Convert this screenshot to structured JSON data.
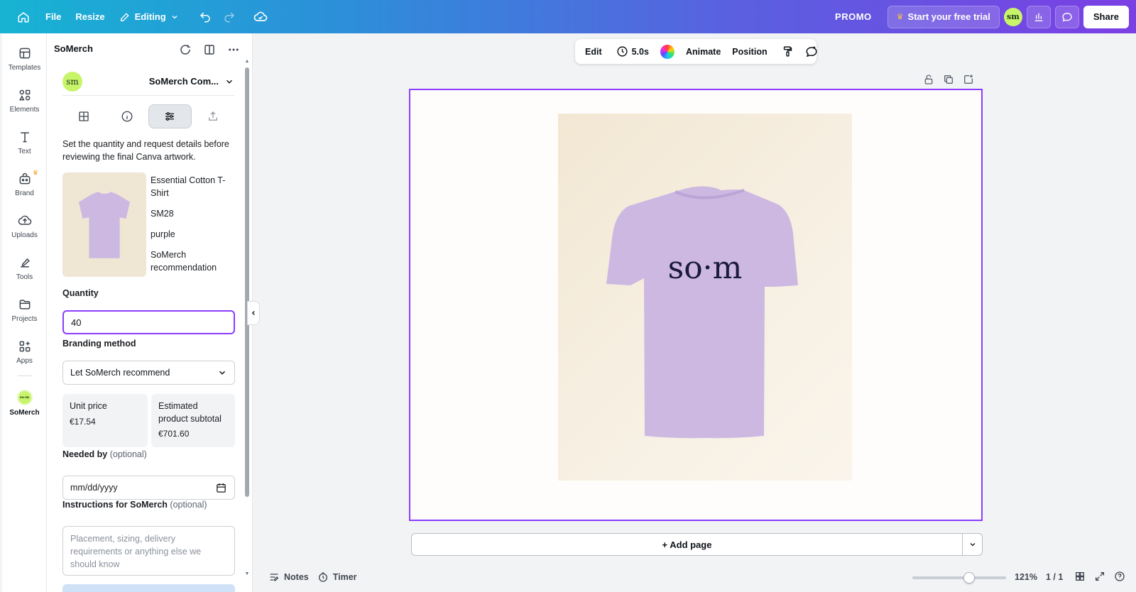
{
  "topbar": {
    "file_label": "File",
    "resize_label": "Resize",
    "editing_label": "Editing",
    "promo_label": "PROMO",
    "trial_label": "Start your free trial",
    "avatar_text": "sm",
    "share_label": "Share"
  },
  "rail": {
    "items": [
      {
        "label": "Templates",
        "icon": "templates-icon"
      },
      {
        "label": "Elements",
        "icon": "elements-icon"
      },
      {
        "label": "Text",
        "icon": "text-icon"
      },
      {
        "label": "Brand",
        "icon": "brand-icon"
      },
      {
        "label": "Uploads",
        "icon": "uploads-icon"
      },
      {
        "label": "Tools",
        "icon": "tools-icon"
      },
      {
        "label": "Projects",
        "icon": "projects-icon"
      },
      {
        "label": "Apps",
        "icon": "apps-icon"
      },
      {
        "label": "SoMerch",
        "icon": "somerch-app-icon"
      }
    ]
  },
  "panel": {
    "title": "SoMerch",
    "account_logo": "sm",
    "account_name": "SoMerch Com...",
    "description": "Set the quantity and request details before reviewing the final Canva artwork.",
    "product": {
      "name": "Essential Cotton T-Shirt",
      "sku": "SM28",
      "color": "purple",
      "source": "SoMerch recommendation"
    },
    "quantity_label": "Quantity",
    "quantity_value": "40",
    "branding_label": "Branding method",
    "branding_value": "Let SoMerch recommend",
    "unit_price_label": "Unit price",
    "unit_price_value": "€17.54",
    "subtotal_label": "Estimated product subtotal",
    "subtotal_value": "€701.60",
    "needed_by_label": "Needed by",
    "optional_text": "(optional)",
    "date_placeholder": "mm/dd/yyyy",
    "instructions_label": "Instructions for SoMerch",
    "instructions_placeholder": "Placement, sizing, delivery requirements or anything else we should know"
  },
  "context_toolbar": {
    "edit_label": "Edit",
    "duration_label": "5.0s",
    "animate_label": "Animate",
    "position_label": "Position"
  },
  "canvas": {
    "shirt_text": "so·m",
    "add_page_label": "+ Add page"
  },
  "bottom_bar": {
    "notes_label": "Notes",
    "timer_label": "Timer",
    "zoom_label": "121%",
    "page_count": "1 / 1"
  },
  "colors": {
    "accent": "#8b3dff",
    "brand_green": "#c8f46a",
    "shirt": "#cdb8e2"
  }
}
